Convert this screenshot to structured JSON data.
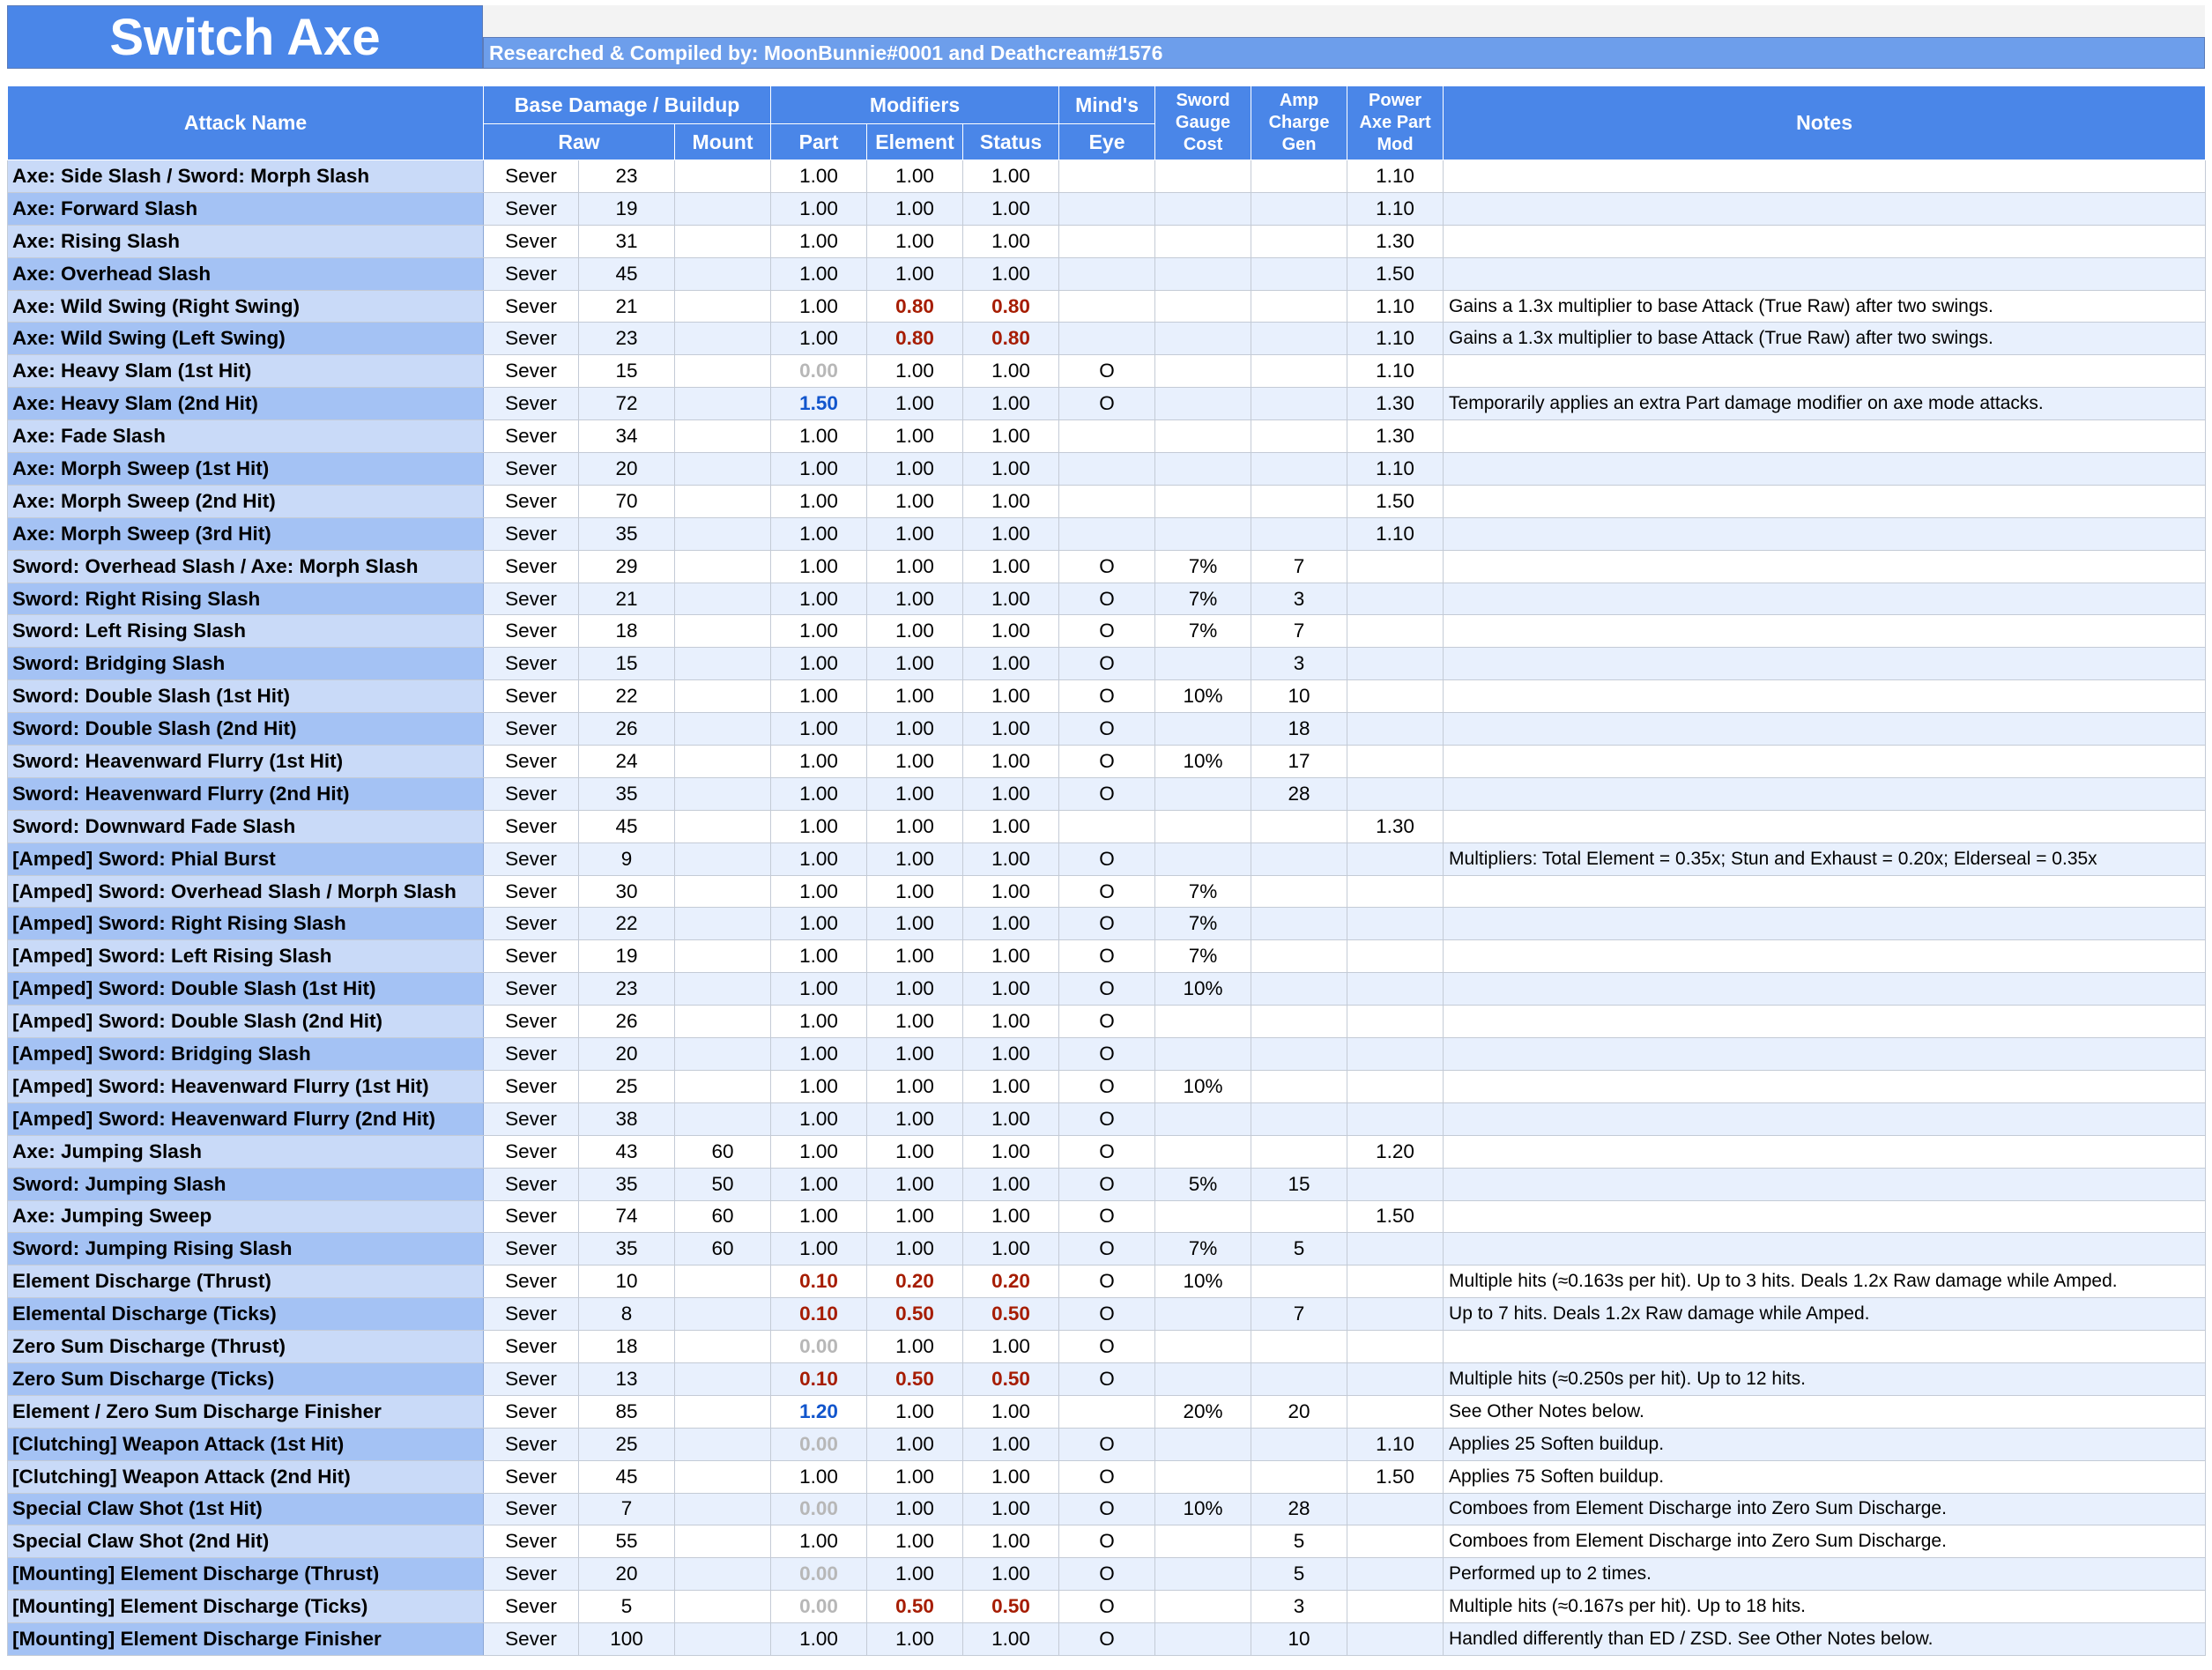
{
  "title": "Switch Axe",
  "credits": "Researched & Compiled by: MoonBunnie#0001 and Deathcream#1576",
  "headers": {
    "attack_name": "Attack Name",
    "base_damage": "Base Damage / Buildup",
    "raw": "Raw",
    "mount": "Mount",
    "modifiers": "Modifiers",
    "part": "Part",
    "element": "Element",
    "status": "Status",
    "minds_eye_1": "Mind's",
    "minds_eye_2": "Eye",
    "sword_gauge_1": "Sword",
    "sword_gauge_2": "Gauge",
    "sword_gauge_3": "Cost",
    "amp_charge_1": "Amp",
    "amp_charge_2": "Charge",
    "amp_charge_3": "Gen",
    "power_axe_1": "Power",
    "power_axe_2": "Axe Part",
    "power_axe_3": "Mod",
    "notes": "Notes"
  },
  "rows": [
    {
      "name": "Axe: Side Slash / Sword: Morph Slash",
      "type": "Sever",
      "raw": "23",
      "mount": "",
      "part": "1.00",
      "element": "1.00",
      "status": "1.00",
      "eye": "",
      "gauge": "",
      "amp": "",
      "pam": "1.10",
      "notes": ""
    },
    {
      "name": "Axe: Forward Slash",
      "type": "Sever",
      "raw": "19",
      "mount": "",
      "part": "1.00",
      "element": "1.00",
      "status": "1.00",
      "eye": "",
      "gauge": "",
      "amp": "",
      "pam": "1.10",
      "notes": ""
    },
    {
      "name": "Axe: Rising Slash",
      "type": "Sever",
      "raw": "31",
      "mount": "",
      "part": "1.00",
      "element": "1.00",
      "status": "1.00",
      "eye": "",
      "gauge": "",
      "amp": "",
      "pam": "1.30",
      "notes": ""
    },
    {
      "name": "Axe: Overhead Slash",
      "type": "Sever",
      "raw": "45",
      "mount": "",
      "part": "1.00",
      "element": "1.00",
      "status": "1.00",
      "eye": "",
      "gauge": "",
      "amp": "",
      "pam": "1.50",
      "notes": ""
    },
    {
      "name": "Axe: Wild Swing (Right Swing)",
      "type": "Sever",
      "raw": "21",
      "mount": "",
      "part": "1.00",
      "element": "0.80",
      "status": "0.80",
      "eye": "",
      "gauge": "",
      "amp": "",
      "pam": "1.10",
      "notes": "Gains a 1.3x multiplier to base Attack (True Raw) after two swings."
    },
    {
      "name": "Axe: Wild Swing (Left Swing)",
      "type": "Sever",
      "raw": "23",
      "mount": "",
      "part": "1.00",
      "element": "0.80",
      "status": "0.80",
      "eye": "",
      "gauge": "",
      "amp": "",
      "pam": "1.10",
      "notes": "Gains a 1.3x multiplier to base Attack (True Raw) after two swings."
    },
    {
      "name": "Axe: Heavy Slam (1st Hit)",
      "type": "Sever",
      "raw": "15",
      "mount": "",
      "part": "0.00",
      "element": "1.00",
      "status": "1.00",
      "eye": "O",
      "gauge": "",
      "amp": "",
      "pam": "1.10",
      "notes": ""
    },
    {
      "name": "Axe: Heavy Slam (2nd Hit)",
      "type": "Sever",
      "raw": "72",
      "mount": "",
      "part": "1.50",
      "element": "1.00",
      "status": "1.00",
      "eye": "O",
      "gauge": "",
      "amp": "",
      "pam": "1.30",
      "notes": "Temporarily applies an extra Part damage modifier on axe mode attacks."
    },
    {
      "name": "Axe: Fade Slash",
      "type": "Sever",
      "raw": "34",
      "mount": "",
      "part": "1.00",
      "element": "1.00",
      "status": "1.00",
      "eye": "",
      "gauge": "",
      "amp": "",
      "pam": "1.30",
      "notes": ""
    },
    {
      "name": "Axe: Morph Sweep (1st Hit)",
      "type": "Sever",
      "raw": "20",
      "mount": "",
      "part": "1.00",
      "element": "1.00",
      "status": "1.00",
      "eye": "",
      "gauge": "",
      "amp": "",
      "pam": "1.10",
      "notes": ""
    },
    {
      "name": "Axe: Morph Sweep (2nd Hit)",
      "type": "Sever",
      "raw": "70",
      "mount": "",
      "part": "1.00",
      "element": "1.00",
      "status": "1.00",
      "eye": "",
      "gauge": "",
      "amp": "",
      "pam": "1.50",
      "notes": ""
    },
    {
      "name": "Axe: Morph Sweep (3rd Hit)",
      "type": "Sever",
      "raw": "35",
      "mount": "",
      "part": "1.00",
      "element": "1.00",
      "status": "1.00",
      "eye": "",
      "gauge": "",
      "amp": "",
      "pam": "1.10",
      "notes": ""
    },
    {
      "name": "Sword: Overhead Slash / Axe: Morph Slash",
      "type": "Sever",
      "raw": "29",
      "mount": "",
      "part": "1.00",
      "element": "1.00",
      "status": "1.00",
      "eye": "O",
      "gauge": "7%",
      "amp": "7",
      "pam": "",
      "notes": ""
    },
    {
      "name": "Sword: Right Rising Slash",
      "type": "Sever",
      "raw": "21",
      "mount": "",
      "part": "1.00",
      "element": "1.00",
      "status": "1.00",
      "eye": "O",
      "gauge": "7%",
      "amp": "3",
      "pam": "",
      "notes": ""
    },
    {
      "name": "Sword: Left Rising Slash",
      "type": "Sever",
      "raw": "18",
      "mount": "",
      "part": "1.00",
      "element": "1.00",
      "status": "1.00",
      "eye": "O",
      "gauge": "7%",
      "amp": "7",
      "pam": "",
      "notes": ""
    },
    {
      "name": "Sword: Bridging Slash",
      "type": "Sever",
      "raw": "15",
      "mount": "",
      "part": "1.00",
      "element": "1.00",
      "status": "1.00",
      "eye": "O",
      "gauge": "",
      "amp": "3",
      "pam": "",
      "notes": ""
    },
    {
      "name": "Sword: Double Slash (1st Hit)",
      "type": "Sever",
      "raw": "22",
      "mount": "",
      "part": "1.00",
      "element": "1.00",
      "status": "1.00",
      "eye": "O",
      "gauge": "10%",
      "amp": "10",
      "pam": "",
      "notes": ""
    },
    {
      "name": "Sword: Double Slash (2nd Hit)",
      "type": "Sever",
      "raw": "26",
      "mount": "",
      "part": "1.00",
      "element": "1.00",
      "status": "1.00",
      "eye": "O",
      "gauge": "",
      "amp": "18",
      "pam": "",
      "notes": ""
    },
    {
      "name": "Sword: Heavenward Flurry (1st Hit)",
      "type": "Sever",
      "raw": "24",
      "mount": "",
      "part": "1.00",
      "element": "1.00",
      "status": "1.00",
      "eye": "O",
      "gauge": "10%",
      "amp": "17",
      "pam": "",
      "notes": ""
    },
    {
      "name": "Sword: Heavenward Flurry (2nd Hit)",
      "type": "Sever",
      "raw": "35",
      "mount": "",
      "part": "1.00",
      "element": "1.00",
      "status": "1.00",
      "eye": "O",
      "gauge": "",
      "amp": "28",
      "pam": "",
      "notes": ""
    },
    {
      "name": "Sword: Downward Fade Slash",
      "type": "Sever",
      "raw": "45",
      "mount": "",
      "part": "1.00",
      "element": "1.00",
      "status": "1.00",
      "eye": "",
      "gauge": "",
      "amp": "",
      "pam": "1.30",
      "notes": ""
    },
    {
      "name": "[Amped] Sword: Phial Burst",
      "type": "Sever",
      "raw": "9",
      "mount": "",
      "part": "1.00",
      "element": "1.00",
      "status": "1.00",
      "eye": "O",
      "gauge": "",
      "amp": "",
      "pam": "",
      "notes": "Multipliers: Total Element = 0.35x; Stun and Exhaust = 0.20x; Elderseal = 0.35x"
    },
    {
      "name": "[Amped] Sword: Overhead Slash / Morph Slash",
      "type": "Sever",
      "raw": "30",
      "mount": "",
      "part": "1.00",
      "element": "1.00",
      "status": "1.00",
      "eye": "O",
      "gauge": "7%",
      "amp": "",
      "pam": "",
      "notes": ""
    },
    {
      "name": "[Amped] Sword: Right Rising Slash",
      "type": "Sever",
      "raw": "22",
      "mount": "",
      "part": "1.00",
      "element": "1.00",
      "status": "1.00",
      "eye": "O",
      "gauge": "7%",
      "amp": "",
      "pam": "",
      "notes": ""
    },
    {
      "name": "[Amped] Sword: Left Rising Slash",
      "type": "Sever",
      "raw": "19",
      "mount": "",
      "part": "1.00",
      "element": "1.00",
      "status": "1.00",
      "eye": "O",
      "gauge": "7%",
      "amp": "",
      "pam": "",
      "notes": ""
    },
    {
      "name": "[Amped] Sword: Double Slash (1st Hit)",
      "type": "Sever",
      "raw": "23",
      "mount": "",
      "part": "1.00",
      "element": "1.00",
      "status": "1.00",
      "eye": "O",
      "gauge": "10%",
      "amp": "",
      "pam": "",
      "notes": ""
    },
    {
      "name": "[Amped] Sword: Double Slash (2nd Hit)",
      "type": "Sever",
      "raw": "26",
      "mount": "",
      "part": "1.00",
      "element": "1.00",
      "status": "1.00",
      "eye": "O",
      "gauge": "",
      "amp": "",
      "pam": "",
      "notes": ""
    },
    {
      "name": "[Amped] Sword: Bridging Slash",
      "type": "Sever",
      "raw": "20",
      "mount": "",
      "part": "1.00",
      "element": "1.00",
      "status": "1.00",
      "eye": "O",
      "gauge": "",
      "amp": "",
      "pam": "",
      "notes": ""
    },
    {
      "name": "[Amped] Sword: Heavenward Flurry (1st Hit)",
      "type": "Sever",
      "raw": "25",
      "mount": "",
      "part": "1.00",
      "element": "1.00",
      "status": "1.00",
      "eye": "O",
      "gauge": "10%",
      "amp": "",
      "pam": "",
      "notes": ""
    },
    {
      "name": "[Amped] Sword: Heavenward Flurry (2nd Hit)",
      "type": "Sever",
      "raw": "38",
      "mount": "",
      "part": "1.00",
      "element": "1.00",
      "status": "1.00",
      "eye": "O",
      "gauge": "",
      "amp": "",
      "pam": "",
      "notes": ""
    },
    {
      "name": "Axe: Jumping Slash",
      "type": "Sever",
      "raw": "43",
      "mount": "60",
      "part": "1.00",
      "element": "1.00",
      "status": "1.00",
      "eye": "O",
      "gauge": "",
      "amp": "",
      "pam": "1.20",
      "notes": ""
    },
    {
      "name": "Sword: Jumping Slash",
      "type": "Sever",
      "raw": "35",
      "mount": "50",
      "part": "1.00",
      "element": "1.00",
      "status": "1.00",
      "eye": "O",
      "gauge": "5%",
      "amp": "15",
      "pam": "",
      "notes": ""
    },
    {
      "name": "Axe: Jumping Sweep",
      "type": "Sever",
      "raw": "74",
      "mount": "60",
      "part": "1.00",
      "element": "1.00",
      "status": "1.00",
      "eye": "O",
      "gauge": "",
      "amp": "",
      "pam": "1.50",
      "notes": ""
    },
    {
      "name": "Sword: Jumping Rising Slash",
      "type": "Sever",
      "raw": "35",
      "mount": "60",
      "part": "1.00",
      "element": "1.00",
      "status": "1.00",
      "eye": "O",
      "gauge": "7%",
      "amp": "5",
      "pam": "",
      "notes": ""
    },
    {
      "name": "Element Discharge (Thrust)",
      "type": "Sever",
      "raw": "10",
      "mount": "",
      "part": "0.10",
      "element": "0.20",
      "status": "0.20",
      "eye": "O",
      "gauge": "10%",
      "amp": "",
      "pam": "",
      "notes": "Multiple hits (≈0.163s per hit). Up to 3 hits. Deals 1.2x Raw damage while Amped."
    },
    {
      "name": "Elemental Discharge (Ticks)",
      "type": "Sever",
      "raw": "8",
      "mount": "",
      "part": "0.10",
      "element": "0.50",
      "status": "0.50",
      "eye": "O",
      "gauge": "",
      "amp": "7",
      "pam": "",
      "notes": "Up to 7 hits. Deals 1.2x Raw damage while Amped."
    },
    {
      "name": "Zero Sum Discharge (Thrust)",
      "type": "Sever",
      "raw": "18",
      "mount": "",
      "part": "0.00",
      "element": "1.00",
      "status": "1.00",
      "eye": "O",
      "gauge": "",
      "amp": "",
      "pam": "",
      "notes": ""
    },
    {
      "name": "Zero Sum Discharge (Ticks)",
      "type": "Sever",
      "raw": "13",
      "mount": "",
      "part": "0.10",
      "element": "0.50",
      "status": "0.50",
      "eye": "O",
      "gauge": "",
      "amp": "",
      "pam": "",
      "notes": "Multiple hits (≈0.250s per hit). Up to 12 hits."
    },
    {
      "name": "Element / Zero Sum Discharge Finisher",
      "type": "Sever",
      "raw": "85",
      "mount": "",
      "part": "1.20",
      "element": "1.00",
      "status": "1.00",
      "eye": "",
      "gauge": "20%",
      "amp": "20",
      "pam": "",
      "notes": "See Other Notes below."
    },
    {
      "name": "[Clutching] Weapon Attack (1st Hit)",
      "type": "Sever",
      "raw": "25",
      "mount": "",
      "part": "0.00",
      "element": "1.00",
      "status": "1.00",
      "eye": "O",
      "gauge": "",
      "amp": "",
      "pam": "1.10",
      "notes": "Applies 25 Soften buildup."
    },
    {
      "name": "[Clutching] Weapon Attack (2nd Hit)",
      "type": "Sever",
      "raw": "45",
      "mount": "",
      "part": "1.00",
      "element": "1.00",
      "status": "1.00",
      "eye": "O",
      "gauge": "",
      "amp": "",
      "pam": "1.50",
      "notes": "Applies 75 Soften buildup."
    },
    {
      "name": "Special Claw Shot (1st Hit)",
      "type": "Sever",
      "raw": "7",
      "mount": "",
      "part": "0.00",
      "element": "1.00",
      "status": "1.00",
      "eye": "O",
      "gauge": "10%",
      "amp": "28",
      "pam": "",
      "notes": "Comboes from Element Discharge into Zero Sum Discharge."
    },
    {
      "name": "Special Claw Shot (2nd Hit)",
      "type": "Sever",
      "raw": "55",
      "mount": "",
      "part": "1.00",
      "element": "1.00",
      "status": "1.00",
      "eye": "O",
      "gauge": "",
      "amp": "5",
      "pam": "",
      "notes": "Comboes from Element Discharge into Zero Sum Discharge."
    },
    {
      "name": "[Mounting] Element Discharge (Thrust)",
      "type": "Sever",
      "raw": "20",
      "mount": "",
      "part": "0.00",
      "element": "1.00",
      "status": "1.00",
      "eye": "O",
      "gauge": "",
      "amp": "5",
      "pam": "",
      "notes": "Performed up to 2 times."
    },
    {
      "name": "[Mounting] Element Discharge (Ticks)",
      "type": "Sever",
      "raw": "5",
      "mount": "",
      "part": "0.00",
      "element": "0.50",
      "status": "0.50",
      "eye": "O",
      "gauge": "",
      "amp": "3",
      "pam": "",
      "notes": "Multiple hits (≈0.167s per hit). Up to 18 hits."
    },
    {
      "name": "[Mounting] Element Discharge Finisher",
      "type": "Sever",
      "raw": "100",
      "mount": "",
      "part": "1.00",
      "element": "1.00",
      "status": "1.00",
      "eye": "O",
      "gauge": "",
      "amp": "10",
      "pam": "",
      "notes": "Handled differently than ED / ZSD. See Other Notes below."
    }
  ],
  "colors": {
    "header_blue": "#4a86e8",
    "credits_blue": "#6d9eeb",
    "name_col_odd": "#c9daf8",
    "name_col_even": "#a4c2f4",
    "reduced_red": "#a61c00",
    "boosted_blue": "#1155cc",
    "zero_grey": "#b7b7b7"
  }
}
